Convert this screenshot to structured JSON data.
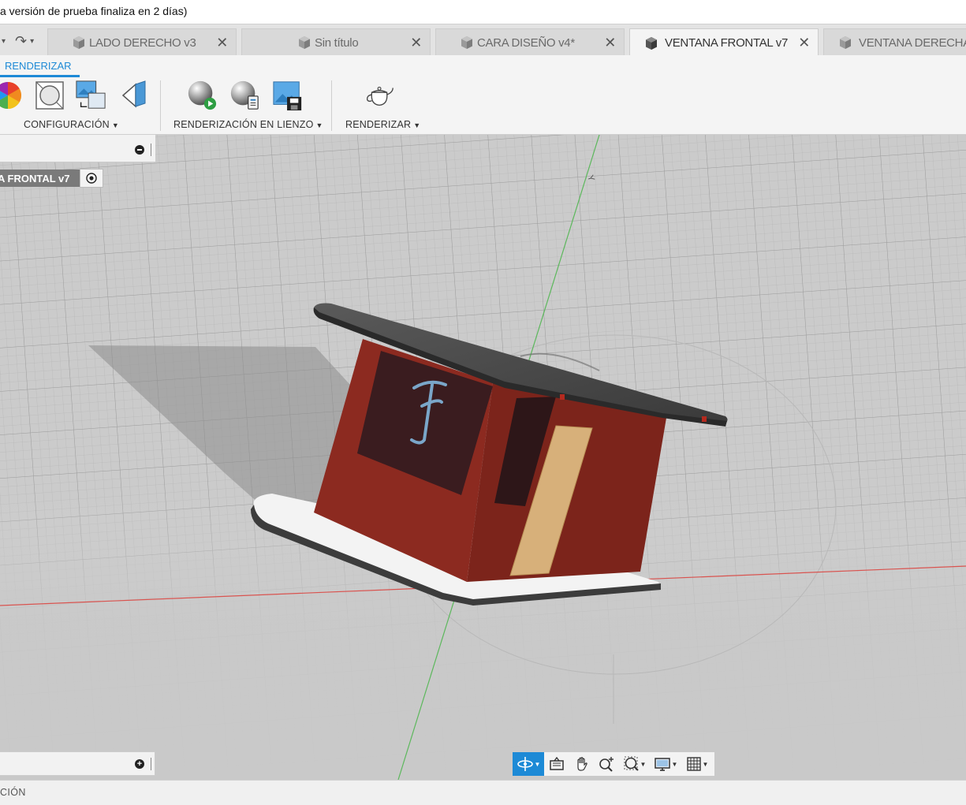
{
  "window": {
    "title_text": "a versión de prueba finaliza en 2 días)"
  },
  "tabs": [
    {
      "label": "LADO DERECHO v3",
      "active": false
    },
    {
      "label": "Sin título",
      "active": false
    },
    {
      "label": "CARA DISEÑO v4*",
      "active": false
    },
    {
      "label": "VENTANA FRONTAL v7",
      "active": true
    },
    {
      "label": "VENTANA DERECHA",
      "active": false
    }
  ],
  "ribbon": {
    "active_tab": "RENDERIZAR",
    "groups": {
      "setup": "CONFIGURACIÓN",
      "canvas_render": "RENDERIZACIÓN EN LIENZO",
      "render": "RENDERIZAR"
    },
    "icons": [
      "appearance-wheel-icon",
      "physical-material-icon",
      "scene-settings-icon",
      "decal-icon",
      "start-canvas-render-icon",
      "canvas-render-settings-icon",
      "capture-image-icon",
      "render-teapot-icon"
    ]
  },
  "browser": {
    "document_node": "A FRONTAL v7"
  },
  "viewport": {
    "axis_label": "Y"
  },
  "navbar": {
    "tools": [
      "orbit-icon",
      "look-at-icon",
      "pan-icon",
      "zoom-icon",
      "zoom-window-icon",
      "display-settings-icon",
      "grid-settings-icon"
    ]
  },
  "statusbar": {
    "text": "CIÓN"
  },
  "colors": {
    "accent": "#1d8ad6",
    "wall_red": "#8c2a20",
    "roof_dark": "#4a4a4a",
    "door_wood": "#d7b07a",
    "viewport_bg": "#c9c9c9"
  }
}
